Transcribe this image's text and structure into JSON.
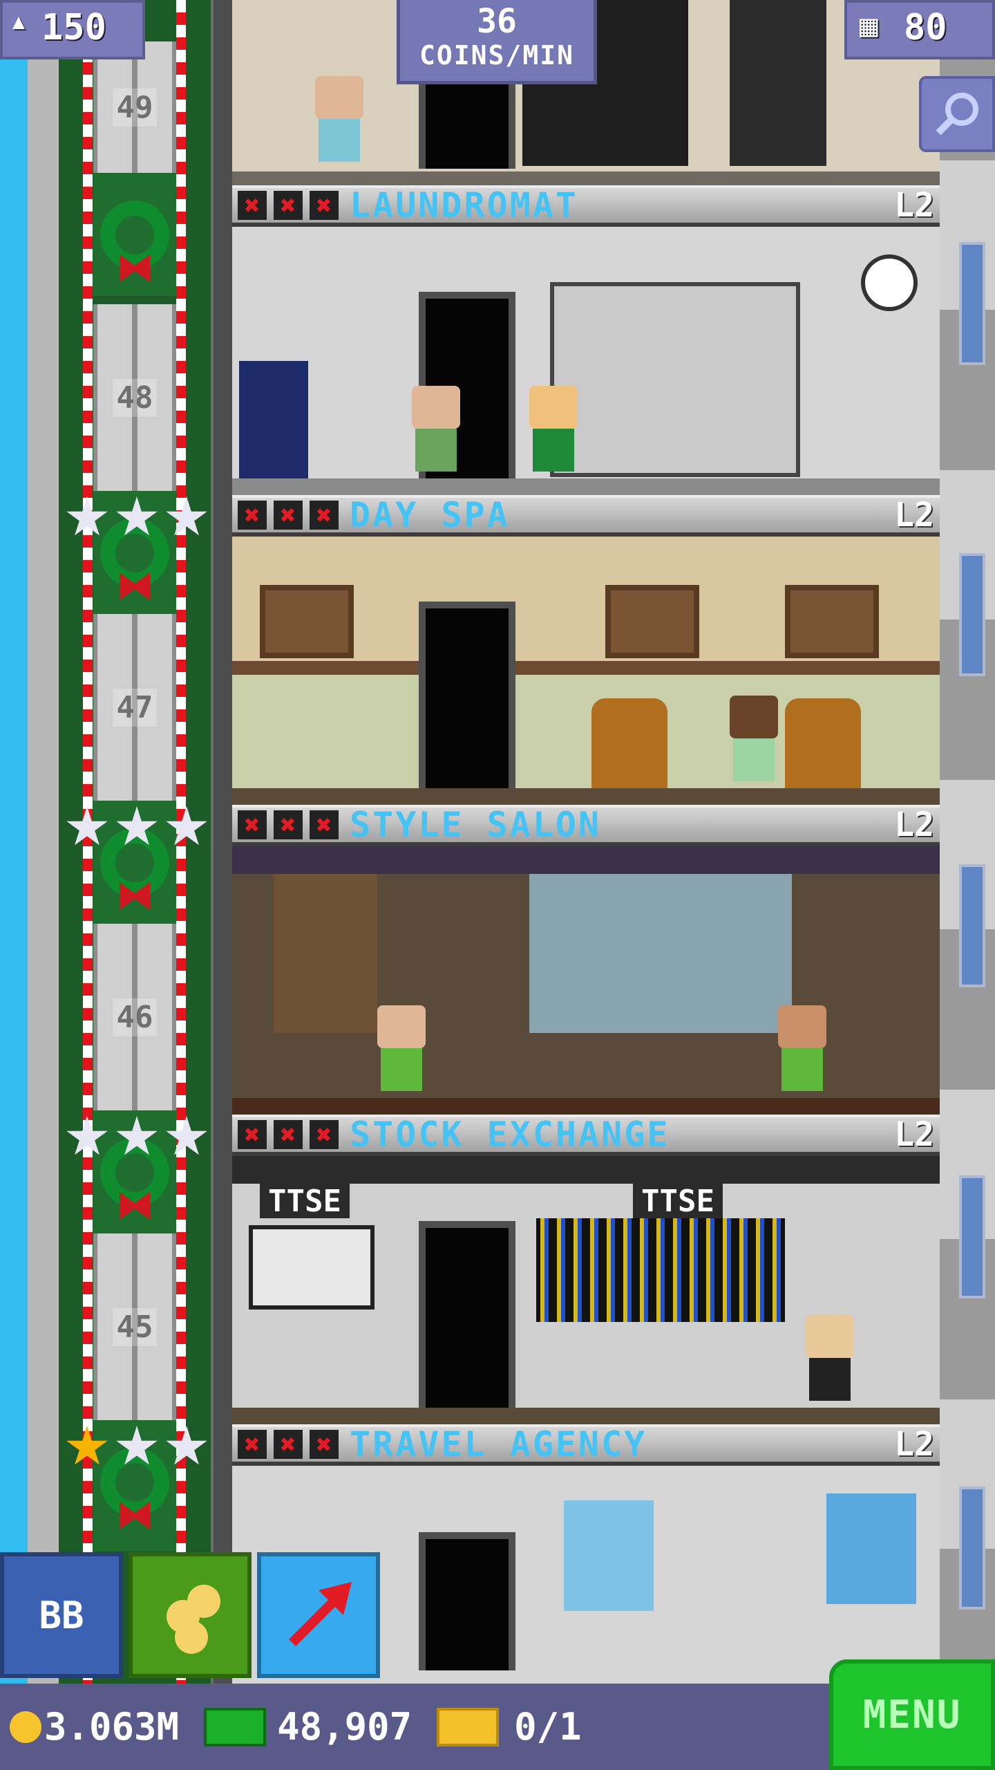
{
  "hud": {
    "population": "150",
    "coins_per_min_value": "36",
    "coins_per_min_label": "COINS/MIN",
    "floors": "80"
  },
  "elevator": {
    "floor_labels": [
      "49",
      "48",
      "47",
      "46",
      "45"
    ]
  },
  "floors": [
    {
      "name": "LAUNDROMAT",
      "level": "L2",
      "marks": [
        "✖",
        "✖",
        "✖"
      ]
    },
    {
      "name": "DAY SPA",
      "level": "L2",
      "marks": [
        "✖",
        "✖",
        "✖"
      ]
    },
    {
      "name": "STYLE SALON",
      "level": "L2",
      "marks": [
        "✖",
        "✖",
        "✖"
      ]
    },
    {
      "name": "STOCK EXCHANGE",
      "level": "L2",
      "marks": [
        "✖",
        "✖",
        "✖"
      ]
    },
    {
      "name": "TRAVEL AGENCY",
      "level": "L2",
      "marks": [
        "✖",
        "✖",
        "✖"
      ]
    }
  ],
  "stock_exchange_signs": [
    "TTSE",
    "TTSE"
  ],
  "toolbar": {
    "bb_label": "BB",
    "coins_icon": "coins-icon",
    "arrow_icon": "up-arrow-icon"
  },
  "bottom": {
    "coins": "3.063M",
    "bux": "48,907",
    "tickets": "0/1",
    "menu_label": "MENU"
  },
  "colors": {
    "floor_name": "#45c3f5",
    "x_mark": "#e21b24",
    "menu_bg": "#1ec42c",
    "hud_bg": "#7578b4"
  }
}
